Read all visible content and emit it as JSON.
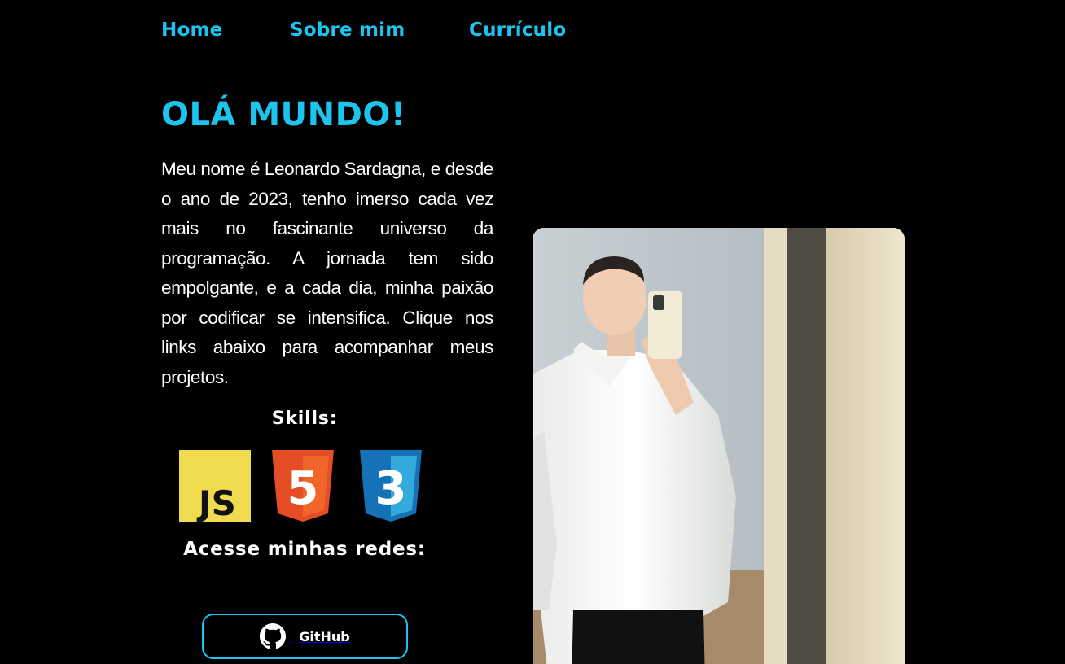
{
  "nav": {
    "items": [
      {
        "label": "Home"
      },
      {
        "label": "Sobre mim"
      },
      {
        "label": "Currículo"
      }
    ]
  },
  "hero": {
    "title": "OLÁ MUNDO!",
    "intro": "Meu nome é Leonardo Sardagna, e desde o ano de 2023, tenho imerso cada vez mais no fascinante universo da programação. A jornada tem sido empolgante, e a cada dia, minha paixão por codificar se intensifica. Clique nos links abaixo para acompanhar meus projetos."
  },
  "skills": {
    "title": "Skills:",
    "items": [
      {
        "icon": "javascript-icon",
        "text": "JS",
        "color": "#f0db4f"
      },
      {
        "icon": "html5-icon",
        "text": "5",
        "color": "#e44d26"
      },
      {
        "icon": "css3-icon",
        "text": "3",
        "color": "#2965f1"
      }
    ]
  },
  "networks": {
    "title": "Acesse minhas redes:",
    "github_label": "GitHub"
  },
  "colors": {
    "accent": "#1cc4ee",
    "background": "#000000",
    "text": "#ffffff"
  }
}
